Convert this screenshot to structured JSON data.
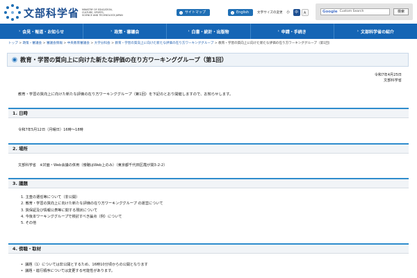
{
  "header": {
    "logo_title": "文部科学省",
    "logo_en": [
      "MINISTRY OF EDUCATION,",
      "CULTURE, SPORTS,",
      "SCIENCE AND TECHNOLOGY-JAPAN"
    ],
    "sitemap": "サイトマップ",
    "english": "English",
    "fontsize_label": "文字サイズの変更",
    "font_small": "小",
    "font_medium": "中",
    "font_large": "大",
    "search_brand": "Google",
    "search_placeholder": "Custom Search",
    "search_button": "検索"
  },
  "nav": [
    "会見・報道・お知らせ",
    "政策・審議会",
    "白書・統計・出版物",
    "申請・手続き",
    "文部科学省の紹介"
  ],
  "breadcrumb": [
    "トップ",
    "政策・審議会",
    "審議会情報",
    "中央教育審議会",
    "大学分科会",
    "教育・学習の質向上に向けた新たな評価の在り方ワーキンググループ",
    "教育・学習の質向上に向けた新たな評価の在り方ワーキンググループ（第1回）"
  ],
  "page_title": "教育・学習の質向上に向けた新たな評価の在り方ワーキンググループ（第1回）",
  "date": "令和7年4月25日",
  "issuer": "文部科学省",
  "lead": "教育・学習の質向上に向けた新たな評価の在り方ワーキンググループ（第1回）を下記のとおり開催しますので、お知らせします。",
  "sections": {
    "datetime": {
      "heading": "1. 日時",
      "body": "令和7年5月12日（月曜日）16時～18時"
    },
    "place": {
      "heading": "2. 場所",
      "body": "文部科学省　※対面・Web会議の併用（傍聴はWeb上のみ）（東京都千代田区霞が関3-2-2）"
    },
    "agenda": {
      "heading": "3. 議題",
      "items": [
        "1. 主査の選任等について（非公開）",
        "2. 教育・学習の質向上に向けた新たな評価の在り方ワーキンググループ の運営について",
        "3. 質保証及び情報公表等に関する現状について",
        "4. 今後本ワーキンググループで検討すべき論点（例）について",
        "5. その他"
      ]
    },
    "coverage": {
      "heading": "4. 傍聴・取材",
      "items": [
        "議題（1）については非公開とするため、16時10分頃からの公開となります",
        "議題・進行順序については変更する可能性があります。"
      ]
    }
  },
  "colors": {
    "brand": "#1565b5",
    "accent": "#2e8ccd"
  }
}
